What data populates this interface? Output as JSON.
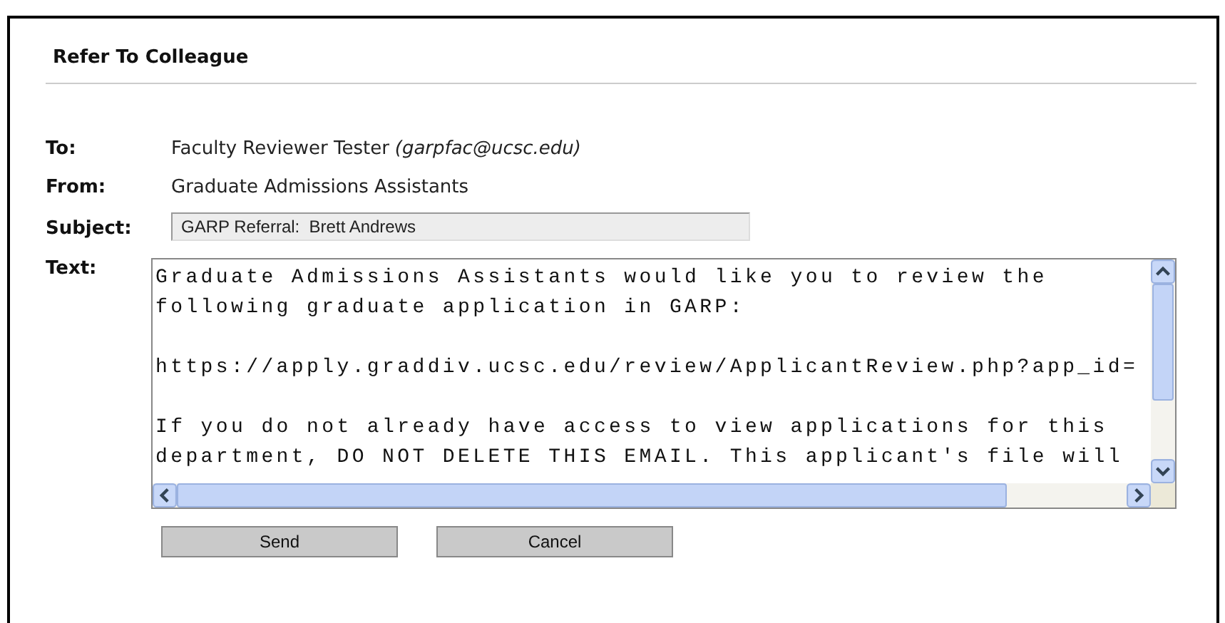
{
  "title": "Refer To Colleague",
  "fields": [
    {
      "kind": "plain",
      "label": "To:",
      "value": "Faculty Reviewer Tester",
      "note": "(garpfac@ucsc.edu)"
    },
    {
      "kind": "plain",
      "label": "From:",
      "value": "Graduate Admissions Assistants"
    },
    {
      "kind": "input",
      "label": "Subject:",
      "value": "GARP Referral:  Brett Andrews"
    },
    {
      "kind": "textarea",
      "label": "Text:",
      "paragraphs": [
        [
          "Graduate Admissions Assistants would like you to review the",
          "following graduate application in GARP:"
        ],
        [
          "https://apply.graddiv.ucsc.edu/review/ApplicantReview.php?app_id="
        ],
        [
          "If you do not already have access to view applications for this",
          "department, DO NOT DELETE THIS EMAIL. This applicant's file will"
        ]
      ]
    }
  ],
  "buttons": [
    "Send",
    "Cancel"
  ]
}
